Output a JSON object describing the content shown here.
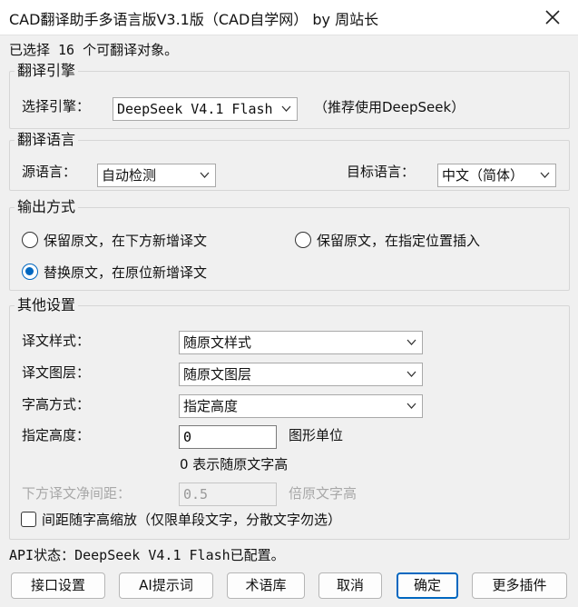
{
  "window": {
    "title": "CAD翻译助手多语言版V3.1版（CAD自学网） by 周站长"
  },
  "selection_info": "已选择 16 个可翻译对象。",
  "engine_group": {
    "title": "翻译引擎",
    "label": "选择引擎：",
    "value": "DeepSeek V4.1 Flash",
    "hint": "（推荐使用DeepSeek）"
  },
  "language_group": {
    "title": "翻译语言",
    "source_label": "源语言：",
    "source_value": "自动检测",
    "target_label": "目标语言：",
    "target_value": "中文（简体）"
  },
  "output_group": {
    "title": "输出方式",
    "options": [
      {
        "label": "保留原文，在下方新增译文",
        "selected": false
      },
      {
        "label": "保留原文，在指定位置插入",
        "selected": false
      },
      {
        "label": "替换原文，在原位新增译文",
        "selected": true
      }
    ]
  },
  "other_group": {
    "title": "其他设置",
    "style_label": "译文样式：",
    "style_value": "随原文样式",
    "layer_label": "译文图层：",
    "layer_value": "随原文图层",
    "height_mode_label": "字高方式：",
    "height_mode_value": "指定高度",
    "height_label": "指定高度：",
    "height_value": "0",
    "height_unit": "图形单位",
    "height_hint": "0 表示随原文字高",
    "spacing_label": "下方译文净间距：",
    "spacing_value": "0.5",
    "spacing_unit": "倍原文字高",
    "scale_checkbox_label": "间距随字高缩放（仅限单段文字，分散文字勿选）"
  },
  "api_status": "API状态：DeepSeek V4.1 Flash已配置。",
  "buttons": {
    "api_settings": "接口设置",
    "ai_prompt": "AI提示词",
    "glossary": "术语库",
    "cancel": "取消",
    "ok": "确定",
    "more_plugins": "更多插件"
  },
  "colors": {
    "accent": "#0067c0",
    "background": "#f0f0f0"
  }
}
